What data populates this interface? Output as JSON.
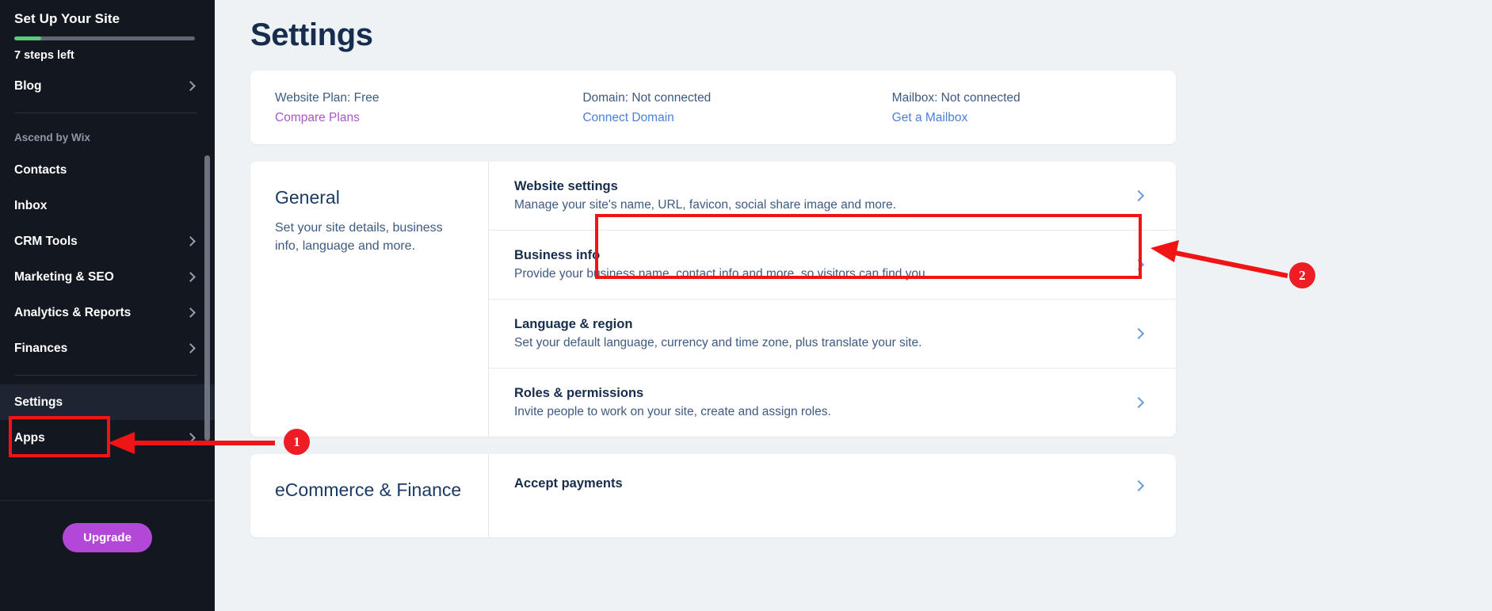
{
  "sidebar": {
    "setup": {
      "title": "Set Up Your Site",
      "steps_left": "7 steps left",
      "progress_percent": 15,
      "progress_color": "#5ec77f"
    },
    "items": [
      {
        "label": "Blog",
        "chevron": true,
        "muted": false,
        "active": false
      },
      {
        "label": "Ascend by Wix",
        "chevron": false,
        "muted": true,
        "active": false
      },
      {
        "label": "Contacts",
        "chevron": false,
        "muted": false,
        "active": false
      },
      {
        "label": "Inbox",
        "chevron": false,
        "muted": false,
        "active": false
      },
      {
        "label": "CRM Tools",
        "chevron": true,
        "muted": false,
        "active": false
      },
      {
        "label": "Marketing & SEO",
        "chevron": true,
        "muted": false,
        "active": false
      },
      {
        "label": "Analytics & Reports",
        "chevron": true,
        "muted": false,
        "active": false
      },
      {
        "label": "Finances",
        "chevron": true,
        "muted": false,
        "active": false
      },
      {
        "label": "Settings",
        "chevron": false,
        "muted": false,
        "active": true
      },
      {
        "label": "Apps",
        "chevron": true,
        "muted": false,
        "active": false
      }
    ],
    "upgrade_label": "Upgrade"
  },
  "header": {
    "title": "Settings"
  },
  "status_bar": [
    {
      "label": "Website Plan: Free",
      "link": "Compare Plans",
      "link_color": "#a857c9"
    },
    {
      "label": "Domain: Not connected",
      "link": "Connect Domain",
      "link_color": "#4a7fdb"
    },
    {
      "label": "Mailbox: Not connected",
      "link": "Get a Mailbox",
      "link_color": "#4a7fdb"
    }
  ],
  "sections": [
    {
      "heading": "General",
      "description": "Set your site details, business info, language and more.",
      "rows": [
        {
          "title": "Website settings",
          "description": "Manage your site's name, URL, favicon, social share image and more.",
          "highlighted": true
        },
        {
          "title": "Business info",
          "description": "Provide your business name, contact info and more, so visitors can find you.",
          "highlighted": false
        },
        {
          "title": "Language & region",
          "description": "Set your default language, currency and time zone, plus translate your site.",
          "highlighted": false
        },
        {
          "title": "Roles & permissions",
          "description": "Invite people to work on your site, create and assign roles.",
          "highlighted": false
        }
      ]
    },
    {
      "heading": "eCommerce & Finance",
      "description": "",
      "rows": [
        {
          "title": "Accept payments",
          "description": "",
          "highlighted": false
        }
      ]
    }
  ],
  "annotations": {
    "badge_one": "1",
    "badge_two": "2",
    "color": "#ee1c25"
  }
}
